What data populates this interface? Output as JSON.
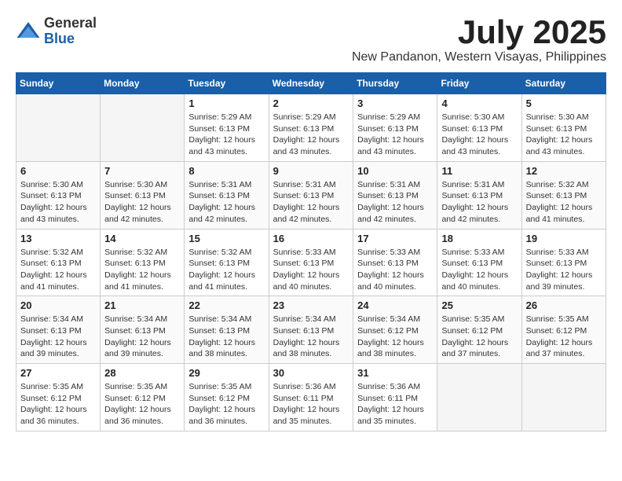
{
  "header": {
    "logo_general": "General",
    "logo_blue": "Blue",
    "month_title": "July 2025",
    "location": "New Pandanon, Western Visayas, Philippines"
  },
  "days_of_week": [
    "Sunday",
    "Monday",
    "Tuesday",
    "Wednesday",
    "Thursday",
    "Friday",
    "Saturday"
  ],
  "weeks": [
    [
      {
        "day": "",
        "empty": true
      },
      {
        "day": "",
        "empty": true
      },
      {
        "day": "1",
        "sunrise": "Sunrise: 5:29 AM",
        "sunset": "Sunset: 6:13 PM",
        "daylight": "Daylight: 12 hours and 43 minutes."
      },
      {
        "day": "2",
        "sunrise": "Sunrise: 5:29 AM",
        "sunset": "Sunset: 6:13 PM",
        "daylight": "Daylight: 12 hours and 43 minutes."
      },
      {
        "day": "3",
        "sunrise": "Sunrise: 5:29 AM",
        "sunset": "Sunset: 6:13 PM",
        "daylight": "Daylight: 12 hours and 43 minutes."
      },
      {
        "day": "4",
        "sunrise": "Sunrise: 5:30 AM",
        "sunset": "Sunset: 6:13 PM",
        "daylight": "Daylight: 12 hours and 43 minutes."
      },
      {
        "day": "5",
        "sunrise": "Sunrise: 5:30 AM",
        "sunset": "Sunset: 6:13 PM",
        "daylight": "Daylight: 12 hours and 43 minutes."
      }
    ],
    [
      {
        "day": "6",
        "sunrise": "Sunrise: 5:30 AM",
        "sunset": "Sunset: 6:13 PM",
        "daylight": "Daylight: 12 hours and 43 minutes."
      },
      {
        "day": "7",
        "sunrise": "Sunrise: 5:30 AM",
        "sunset": "Sunset: 6:13 PM",
        "daylight": "Daylight: 12 hours and 42 minutes."
      },
      {
        "day": "8",
        "sunrise": "Sunrise: 5:31 AM",
        "sunset": "Sunset: 6:13 PM",
        "daylight": "Daylight: 12 hours and 42 minutes."
      },
      {
        "day": "9",
        "sunrise": "Sunrise: 5:31 AM",
        "sunset": "Sunset: 6:13 PM",
        "daylight": "Daylight: 12 hours and 42 minutes."
      },
      {
        "day": "10",
        "sunrise": "Sunrise: 5:31 AM",
        "sunset": "Sunset: 6:13 PM",
        "daylight": "Daylight: 12 hours and 42 minutes."
      },
      {
        "day": "11",
        "sunrise": "Sunrise: 5:31 AM",
        "sunset": "Sunset: 6:13 PM",
        "daylight": "Daylight: 12 hours and 42 minutes."
      },
      {
        "day": "12",
        "sunrise": "Sunrise: 5:32 AM",
        "sunset": "Sunset: 6:13 PM",
        "daylight": "Daylight: 12 hours and 41 minutes."
      }
    ],
    [
      {
        "day": "13",
        "sunrise": "Sunrise: 5:32 AM",
        "sunset": "Sunset: 6:13 PM",
        "daylight": "Daylight: 12 hours and 41 minutes."
      },
      {
        "day": "14",
        "sunrise": "Sunrise: 5:32 AM",
        "sunset": "Sunset: 6:13 PM",
        "daylight": "Daylight: 12 hours and 41 minutes."
      },
      {
        "day": "15",
        "sunrise": "Sunrise: 5:32 AM",
        "sunset": "Sunset: 6:13 PM",
        "daylight": "Daylight: 12 hours and 41 minutes."
      },
      {
        "day": "16",
        "sunrise": "Sunrise: 5:33 AM",
        "sunset": "Sunset: 6:13 PM",
        "daylight": "Daylight: 12 hours and 40 minutes."
      },
      {
        "day": "17",
        "sunrise": "Sunrise: 5:33 AM",
        "sunset": "Sunset: 6:13 PM",
        "daylight": "Daylight: 12 hours and 40 minutes."
      },
      {
        "day": "18",
        "sunrise": "Sunrise: 5:33 AM",
        "sunset": "Sunset: 6:13 PM",
        "daylight": "Daylight: 12 hours and 40 minutes."
      },
      {
        "day": "19",
        "sunrise": "Sunrise: 5:33 AM",
        "sunset": "Sunset: 6:13 PM",
        "daylight": "Daylight: 12 hours and 39 minutes."
      }
    ],
    [
      {
        "day": "20",
        "sunrise": "Sunrise: 5:34 AM",
        "sunset": "Sunset: 6:13 PM",
        "daylight": "Daylight: 12 hours and 39 minutes."
      },
      {
        "day": "21",
        "sunrise": "Sunrise: 5:34 AM",
        "sunset": "Sunset: 6:13 PM",
        "daylight": "Daylight: 12 hours and 39 minutes."
      },
      {
        "day": "22",
        "sunrise": "Sunrise: 5:34 AM",
        "sunset": "Sunset: 6:13 PM",
        "daylight": "Daylight: 12 hours and 38 minutes."
      },
      {
        "day": "23",
        "sunrise": "Sunrise: 5:34 AM",
        "sunset": "Sunset: 6:13 PM",
        "daylight": "Daylight: 12 hours and 38 minutes."
      },
      {
        "day": "24",
        "sunrise": "Sunrise: 5:34 AM",
        "sunset": "Sunset: 6:12 PM",
        "daylight": "Daylight: 12 hours and 38 minutes."
      },
      {
        "day": "25",
        "sunrise": "Sunrise: 5:35 AM",
        "sunset": "Sunset: 6:12 PM",
        "daylight": "Daylight: 12 hours and 37 minutes."
      },
      {
        "day": "26",
        "sunrise": "Sunrise: 5:35 AM",
        "sunset": "Sunset: 6:12 PM",
        "daylight": "Daylight: 12 hours and 37 minutes."
      }
    ],
    [
      {
        "day": "27",
        "sunrise": "Sunrise: 5:35 AM",
        "sunset": "Sunset: 6:12 PM",
        "daylight": "Daylight: 12 hours and 36 minutes."
      },
      {
        "day": "28",
        "sunrise": "Sunrise: 5:35 AM",
        "sunset": "Sunset: 6:12 PM",
        "daylight": "Daylight: 12 hours and 36 minutes."
      },
      {
        "day": "29",
        "sunrise": "Sunrise: 5:35 AM",
        "sunset": "Sunset: 6:12 PM",
        "daylight": "Daylight: 12 hours and 36 minutes."
      },
      {
        "day": "30",
        "sunrise": "Sunrise: 5:36 AM",
        "sunset": "Sunset: 6:11 PM",
        "daylight": "Daylight: 12 hours and 35 minutes."
      },
      {
        "day": "31",
        "sunrise": "Sunrise: 5:36 AM",
        "sunset": "Sunset: 6:11 PM",
        "daylight": "Daylight: 12 hours and 35 minutes."
      },
      {
        "day": "",
        "empty": true
      },
      {
        "day": "",
        "empty": true
      }
    ]
  ]
}
